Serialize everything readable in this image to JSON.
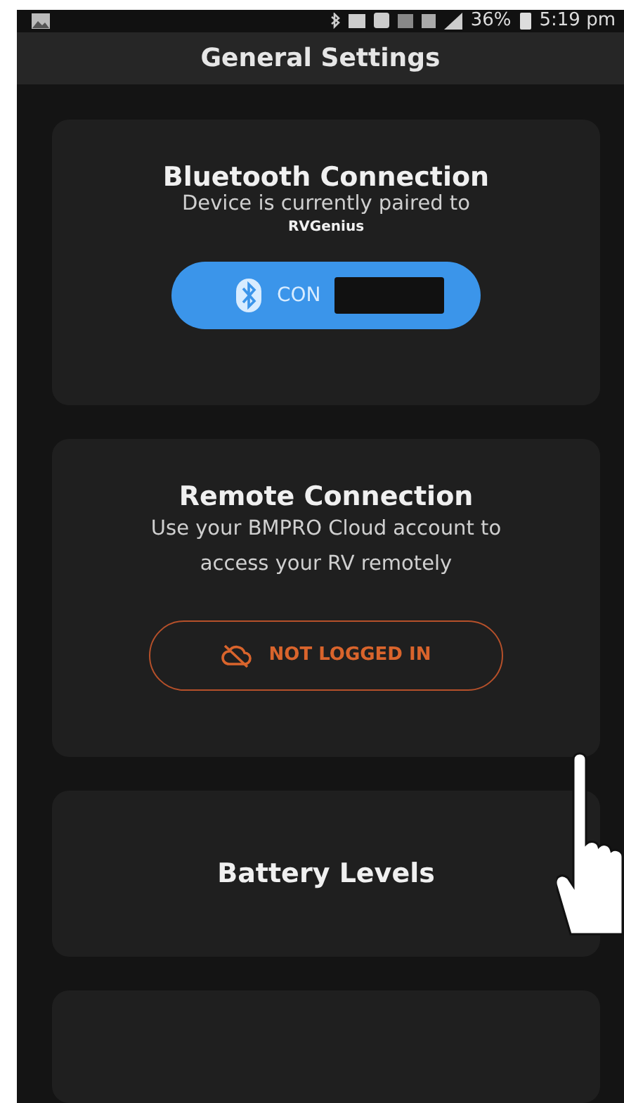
{
  "status_bar": {
    "battery": "36%",
    "time": "5:19 pm"
  },
  "header": {
    "title": "General Settings"
  },
  "cards": [
    {
      "kind": "bluetooth",
      "title": "Bluetooth Connection",
      "description": "Device is currently paired to",
      "device": "RVGenius",
      "button": {
        "label": "CON",
        "redacted": true
      }
    },
    {
      "kind": "remote",
      "title": "Remote Connection",
      "description": "Use your BMPRO Cloud account to access your RV remotely",
      "button": {
        "label": "NOT LOGGED IN"
      }
    },
    {
      "kind": "plain",
      "title": "Battery Levels"
    },
    {
      "kind": "cutoff"
    }
  ]
}
